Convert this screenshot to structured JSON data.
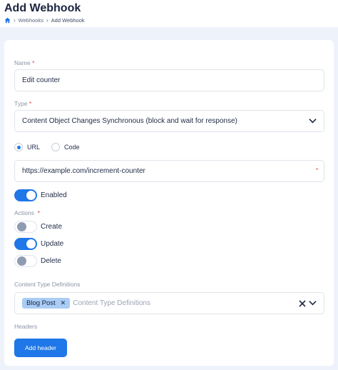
{
  "header": {
    "title": "Add Webhook",
    "breadcrumb": [
      "Webhooks",
      "Add Webhook"
    ]
  },
  "form": {
    "name": {
      "label": "Name",
      "required": "*",
      "value": "Edit counter"
    },
    "type": {
      "label": "Type",
      "required": "*",
      "value": "Content Object Changes Synchronous (block and wait for response)"
    },
    "target": {
      "options": [
        "URL",
        "Code"
      ],
      "selected": "URL"
    },
    "url": {
      "value": "https://example.com/increment-counter",
      "required": "*"
    },
    "enabled": {
      "label": "Enabled",
      "on": true
    },
    "actions": {
      "label": "Actions",
      "required": "*",
      "items": [
        {
          "label": "Create",
          "on": false
        },
        {
          "label": "Update",
          "on": true
        },
        {
          "label": "Delete",
          "on": false
        }
      ]
    },
    "content_type_definitions": {
      "label": "Content Type Definitions",
      "chips": [
        "Blog Post"
      ],
      "placeholder": "Content Type Definitions"
    },
    "headers": {
      "label": "Headers",
      "add_button": "Add header"
    }
  },
  "colors": {
    "accent": "#1f77e8",
    "chip": "#a9cdf5",
    "required": "#e0403a"
  },
  "icons": [
    "home-icon",
    "chevron-right-icon",
    "chevron-down-icon",
    "close-icon"
  ]
}
